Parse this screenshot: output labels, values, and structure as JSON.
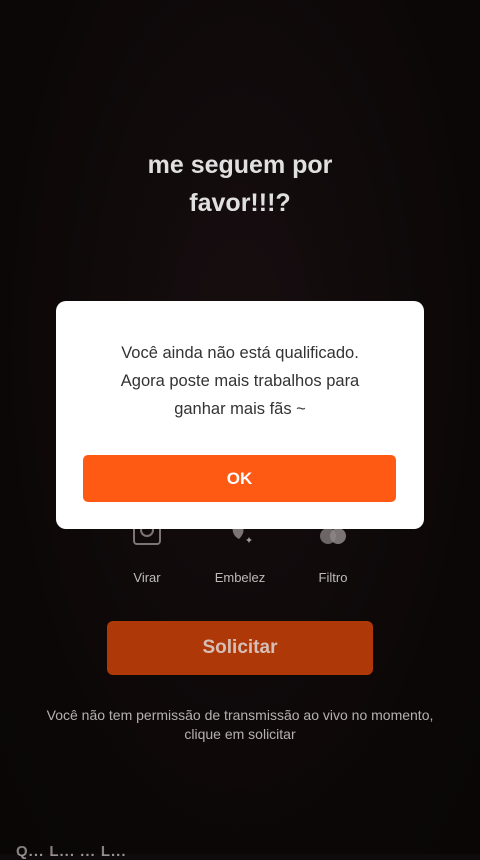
{
  "caption": {
    "line1": "me seguem por",
    "line2": "favor!!!?"
  },
  "controls": [
    {
      "label": "Virar",
      "icon": "flip-camera-icon"
    },
    {
      "label": "Embelez",
      "icon": "beauty-icon"
    },
    {
      "label": "Filtro",
      "icon": "filter-icon"
    }
  ],
  "request_button": {
    "label": "Solicitar"
  },
  "notice": "Você não tem permissão de transmissão ao vivo no momento, clique em solicitar",
  "bottom_partial_text": "Q... L... ... L...",
  "dialog": {
    "line1": "Você ainda não está qualificado.",
    "line2": "Agora poste mais trabalhos para",
    "line3": "ganhar mais fãs ~",
    "ok_label": "OK"
  },
  "colors": {
    "accent": "#ff5a14",
    "request_button": "#c8400a",
    "background": "#0f0a0b"
  }
}
